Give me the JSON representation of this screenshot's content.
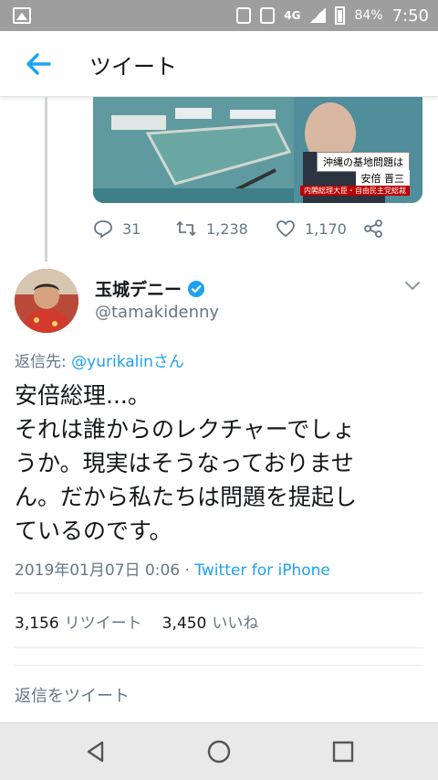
{
  "status_bar": {
    "network": "4G",
    "battery": "84%",
    "time": "7:50"
  },
  "app_bar": {
    "title": "ツイート",
    "back_icon": "arrow-left-icon"
  },
  "quoted_media": {
    "caption_line1": "沖縄の基地問題は",
    "caption_line2": "安倍 晋三",
    "caption_line3": "内閣総理大臣・自由民主党総裁"
  },
  "parent_actions": {
    "replies": "31",
    "retweets": "1,238",
    "likes": "1,170"
  },
  "tweet": {
    "display_name": "玉城デニー",
    "handle": "@tamakidenny",
    "reply_prefix": "返信先: ",
    "reply_mention": "@yurikalin",
    "reply_suffix": "さん",
    "line1": "安倍総理...。",
    "line2": "それは誰からのレクチャーでしょ",
    "line3": "うか。現実はそうなっておりませ",
    "line4": "ん。だから私たちは問題を提起し",
    "line5": "ているのです。",
    "timestamp": "2019年01月07日 0:06 · ",
    "source": "Twitter for iPhone"
  },
  "stats": {
    "retweet_count": "3,156",
    "retweet_label": "リツイート",
    "like_count": "3,450",
    "like_label": "いいね"
  },
  "reply_box": {
    "placeholder": "返信をツイート"
  },
  "colors": {
    "accent": "#1da1f2",
    "muted": "#657786",
    "text": "#14171a"
  }
}
